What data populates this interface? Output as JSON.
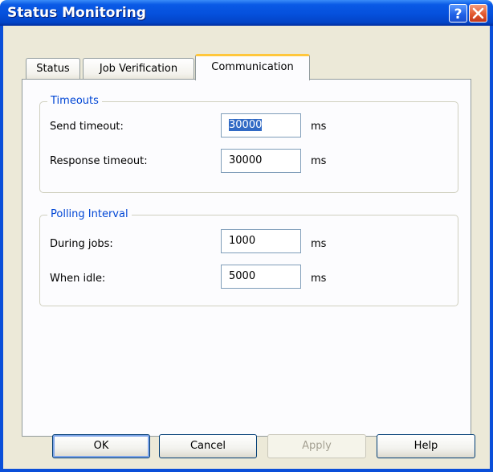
{
  "window": {
    "title": "Status Monitoring",
    "help_button": "?",
    "close_button": "close"
  },
  "tabs": [
    {
      "label": "Status",
      "active": false
    },
    {
      "label": "Job Verification",
      "active": false
    },
    {
      "label": "Communication",
      "active": true
    }
  ],
  "timeouts": {
    "legend": "Timeouts",
    "send_label": "Send timeout:",
    "send_value": "30000",
    "send_unit": "ms",
    "response_label": "Response timeout:",
    "response_value": "30000",
    "response_unit": "ms"
  },
  "polling": {
    "legend": "Polling Interval",
    "during_label": "During jobs:",
    "during_value": "1000",
    "during_unit": "ms",
    "idle_label": "When idle:",
    "idle_value": "5000",
    "idle_unit": "ms"
  },
  "buttons": {
    "ok": "OK",
    "cancel": "Cancel",
    "apply": "Apply",
    "help": "Help"
  },
  "colors": {
    "title_bar": "#0550DC",
    "group_legend": "#0046D5",
    "active_tab_highlight": "#FFC73C",
    "selection": "#316AC5"
  }
}
